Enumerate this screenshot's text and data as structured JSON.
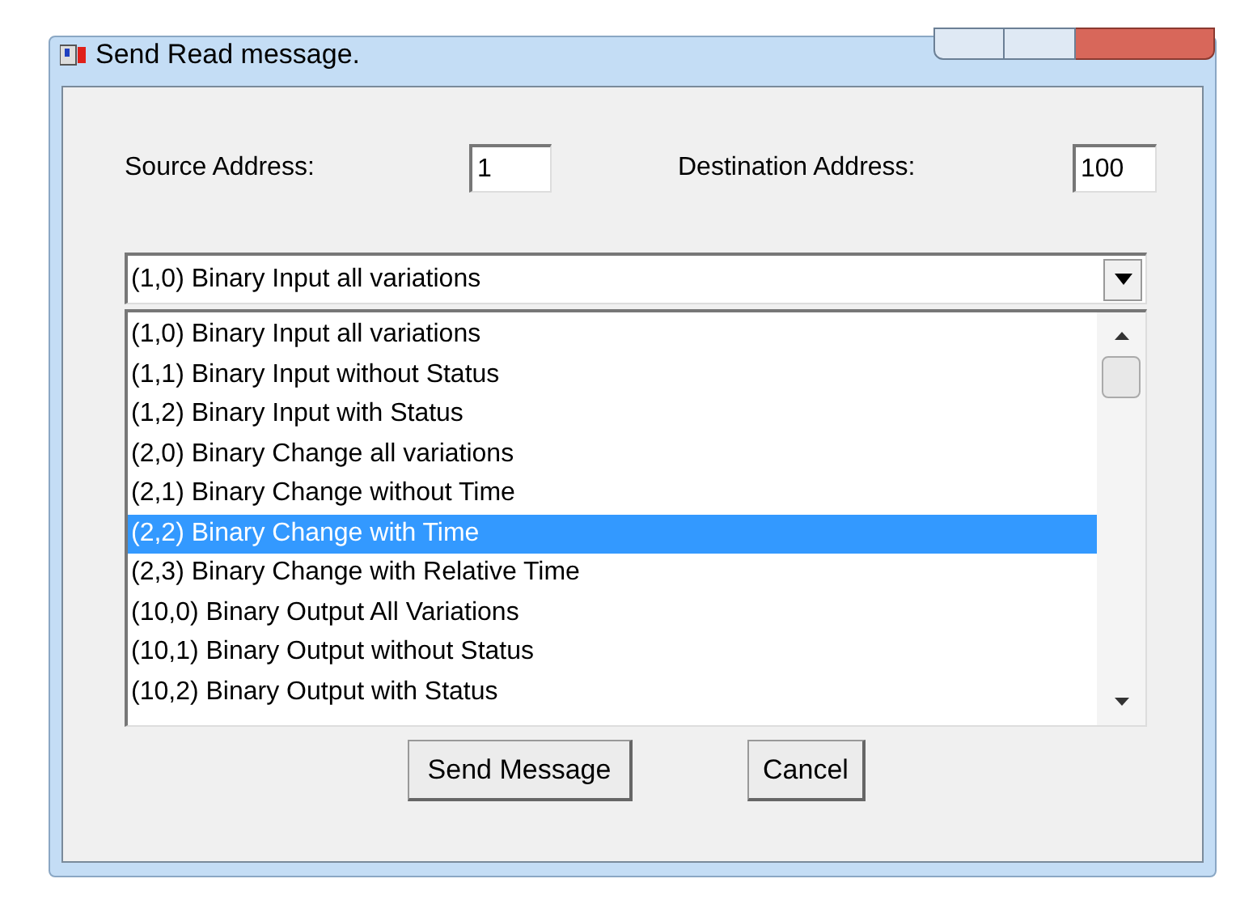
{
  "window": {
    "title": "Send Read message."
  },
  "source_address": {
    "label": "Source Address:",
    "value": "1"
  },
  "destination_address": {
    "label": "Destination Address:",
    "value": "100"
  },
  "object_combo": {
    "value": "(1,0) Binary Input all variations"
  },
  "object_list": [
    {
      "label": "(1,0) Binary Input all variations",
      "selected": false
    },
    {
      "label": "(1,1) Binary Input without Status",
      "selected": false
    },
    {
      "label": "(1,2) Binary Input with Status",
      "selected": false
    },
    {
      "label": "(2,0) Binary Change all variations",
      "selected": false
    },
    {
      "label": "(2,1) Binary Change without Time",
      "selected": false
    },
    {
      "label": "(2,2) Binary Change with Time",
      "selected": true
    },
    {
      "label": "(2,3) Binary Change with Relative Time",
      "selected": false
    },
    {
      "label": "(10,0) Binary Output All Variations",
      "selected": false
    },
    {
      "label": "(10,1) Binary Output without Status",
      "selected": false
    },
    {
      "label": "(10,2) Binary Output with Status",
      "selected": false
    }
  ],
  "buttons": [
    "Send Message",
    "Cancel"
  ]
}
